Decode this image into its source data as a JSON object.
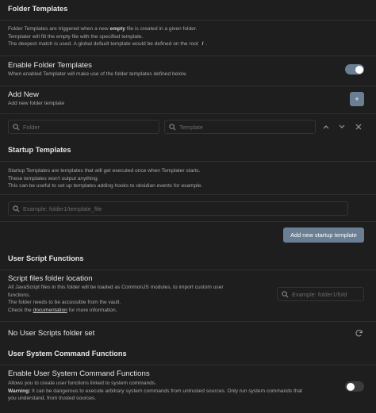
{
  "colors": {
    "background": "#1e1e1e",
    "accent_button": "#6a7f93",
    "toggle_on": "#6a7f93",
    "toggle_off": "#3b3b3b"
  },
  "folder_templates": {
    "title": "Folder Templates",
    "desc_1a": "Folder Templates are triggered when a new ",
    "desc_1b": "empty",
    "desc_1c": " file is created in a given folder.",
    "desc_2": "Templater will fill the empty file with the specified template.",
    "desc_3a": "The deepest match is used. A global default template would be defined on the root ",
    "desc_3b": "/",
    "desc_3c": "."
  },
  "enable_folder_templates": {
    "name": "Enable Folder Templates",
    "desc": "When enabled Templater will make use of the folder templates defined below.",
    "toggle_on": true,
    "toggle_icon": "toggle-switch"
  },
  "add_new": {
    "name": "Add New",
    "desc": "Add new folder template",
    "button_icon": "plus-icon",
    "button_glyph": "+"
  },
  "folder_template_row": {
    "folder_placeholder": "Folder",
    "template_placeholder": "Template",
    "search_glyph": "⌕",
    "up_glyph": "⌃",
    "down_glyph": "⌄",
    "delete_glyph": "✕"
  },
  "startup_templates": {
    "title": "Startup Templates",
    "desc_1": "Startup Templates are templates that will get executed once when Templater starts.",
    "desc_2": "These templates won't output anything.",
    "desc_3": "This can be useful to set up templates adding hooks to obsidian events for example.",
    "input_placeholder": "Example: folder1/template_file",
    "add_button_label": "Add new startup template"
  },
  "user_script_functions": {
    "title": "User Script Functions",
    "folder_location_name": "Script files folder location",
    "desc_1": "All JavaScript files in this folder will be loaded as CommonJS modules, to import custom user",
    "desc_2": "functions.",
    "desc_3": "The folder needs to be accessible from the vault.",
    "desc_4a": "Check the ",
    "desc_4_link": "documentation",
    "desc_4b": " for more information.",
    "folder_input_placeholder": "Example: folder1/fold",
    "no_folder_set": "No User Scripts folder set",
    "refresh_glyph": "⟳"
  },
  "user_system_command_functions": {
    "title": "User System Command Functions",
    "enable_name": "Enable User System Command Functions",
    "desc_1": "Allows you to create user functions linked to system commands.",
    "warning_label": "Warning:",
    "warning_text": " It can be dangerous to execute arbitrary system commands from untrusted sources. Only run system commands that",
    "desc_3": "you understand, from trusted sources.",
    "toggle_on": false
  }
}
